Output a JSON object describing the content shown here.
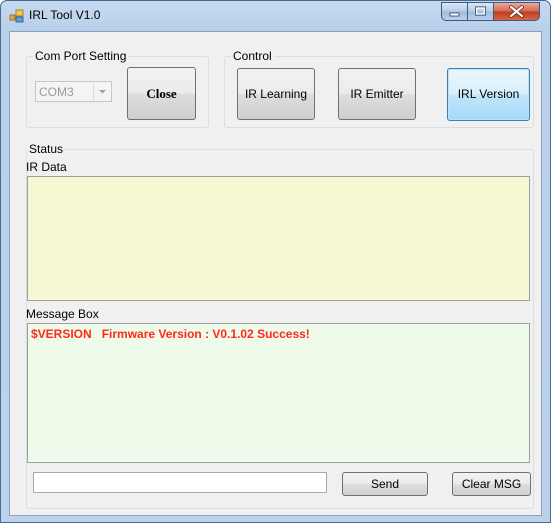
{
  "window": {
    "title": "IRL Tool V1.0"
  },
  "com_port": {
    "legend": "Com Port Setting",
    "port_value": "COM3",
    "close_label": "Close"
  },
  "control": {
    "legend": "Control",
    "ir_learning_label": "IR Learning",
    "ir_emitter_label": "IR Emitter",
    "irl_version_label": "IRL Version"
  },
  "status": {
    "legend": "Status",
    "ir_data_label": "IR Data",
    "ir_data_text": "",
    "message_box_label": "Message Box",
    "message_text": "$VERSION   Firmware Version : V0.1.02 Success!"
  },
  "bottom": {
    "send_input_value": "",
    "send_label": "Send",
    "clear_label": "Clear MSG"
  },
  "colors": {
    "ir_data_bg": "#f8f7d4",
    "message_bg": "#eefbea",
    "message_text": "#ff2a1a"
  }
}
